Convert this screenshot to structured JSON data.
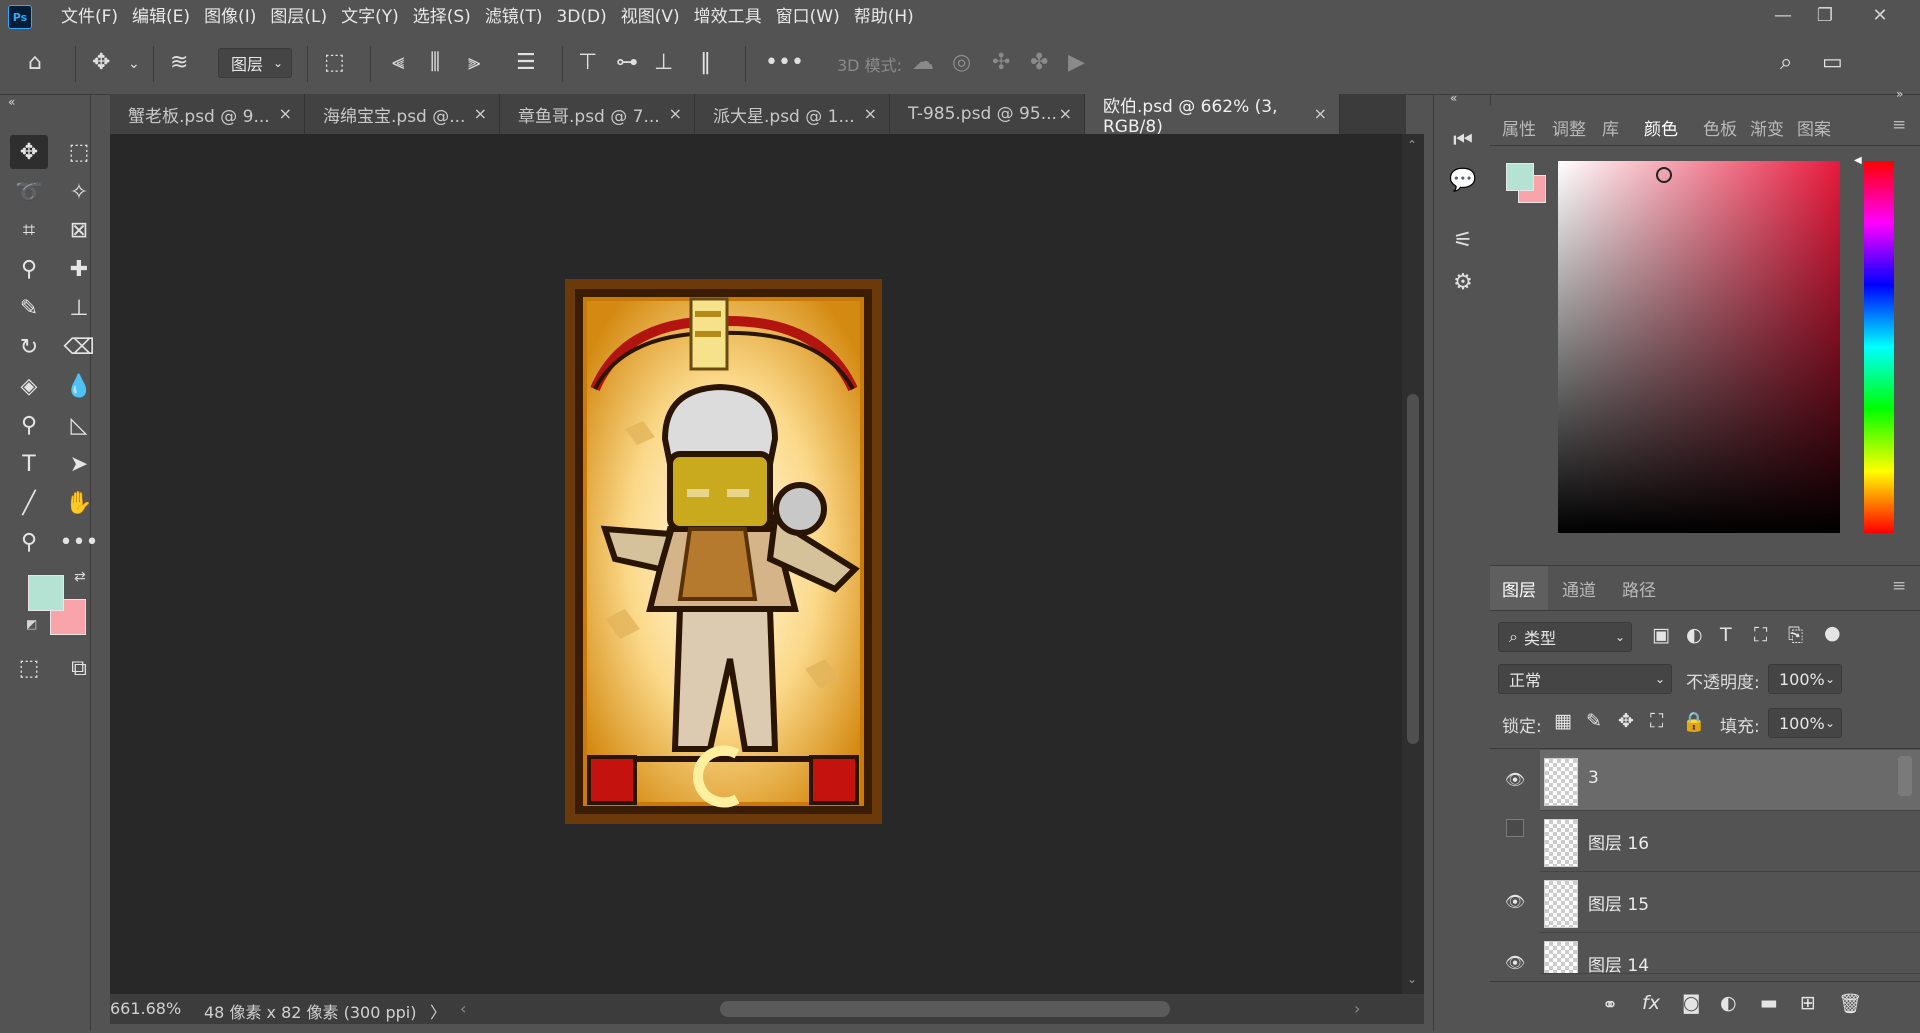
{
  "menubar": {
    "logo": "Ps",
    "items": [
      "文件(F)",
      "编辑(E)",
      "图像(I)",
      "图层(L)",
      "文字(Y)",
      "选择(S)",
      "滤镜(T)",
      "3D(D)",
      "视图(V)",
      "增效工具",
      "窗口(W)",
      "帮助(H)"
    ],
    "window_controls": [
      "—",
      "❐",
      "✕"
    ]
  },
  "options": {
    "layer_select": "图层",
    "mode3d_label": "3D 模式:"
  },
  "tabs": [
    {
      "label": "蟹老板.psd @ 9...",
      "close": "×"
    },
    {
      "label": "海绵宝宝.psd @...",
      "close": "×"
    },
    {
      "label": "章鱼哥.psd @ 7...",
      "close": "×"
    },
    {
      "label": "派大星.psd @ 1...",
      "close": "×"
    },
    {
      "label": "T-985.psd @ 95...",
      "close": "×"
    },
    {
      "label": "欧伯.psd @ 662% (3, RGB/8)",
      "close": "×"
    }
  ],
  "status": {
    "zoom": "661.68%",
    "doc_info": "48 像素 x 82 像素 (300 ppi)",
    "arrow": "〉"
  },
  "colors": {
    "foreground": "#b5e3d3",
    "background": "#f9a3aa"
  },
  "color_panel": {
    "tabs": [
      "属性",
      "调整",
      "库",
      "颜色",
      "色板",
      "渐变",
      "图案"
    ],
    "active_tab": "颜色"
  },
  "layers_panel": {
    "tabs": [
      "图层",
      "通道",
      "路径"
    ],
    "filter_label": "类型",
    "blend_mode": "正常",
    "opacity_label": "不透明度:",
    "opacity_value": "100%",
    "lock_label": "锁定:",
    "fill_label": "填充:",
    "fill_value": "100%",
    "layers": [
      {
        "name": "3",
        "visible": true,
        "selected": true
      },
      {
        "name": "图层 16",
        "visible": false,
        "selected": false
      },
      {
        "name": "图层 15",
        "visible": true,
        "selected": false
      },
      {
        "name": "图层 14",
        "visible": true,
        "selected": false
      }
    ]
  }
}
